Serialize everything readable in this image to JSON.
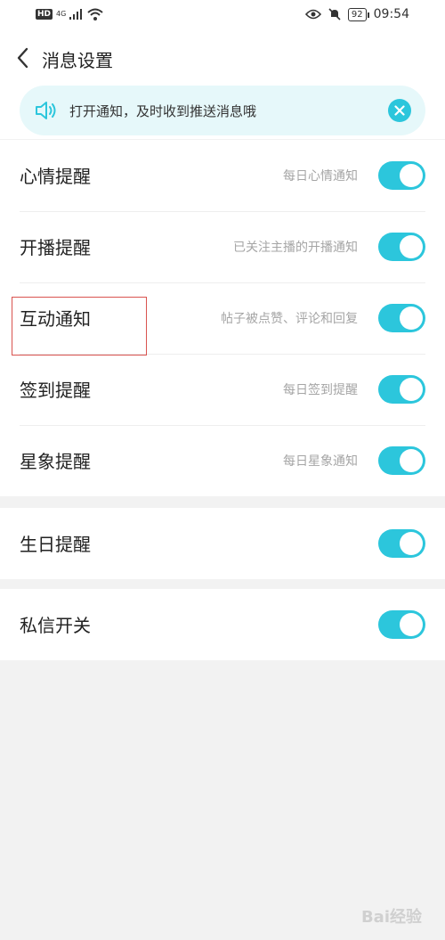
{
  "status_bar": {
    "hd": "HD",
    "network": "4G",
    "battery": "92",
    "time": "09:54"
  },
  "header": {
    "title": "消息设置"
  },
  "banner": {
    "text": "打开通知，及时收到推送消息哦"
  },
  "group1": [
    {
      "title": "心情提醒",
      "subtitle": "每日心情通知",
      "enabled": true
    },
    {
      "title": "开播提醒",
      "subtitle": "已关注主播的开播通知",
      "enabled": true
    },
    {
      "title": "互动通知",
      "subtitle": "帖子被点赞、评论和回复",
      "enabled": true
    },
    {
      "title": "签到提醒",
      "subtitle": "每日签到提醒",
      "enabled": true
    },
    {
      "title": "星象提醒",
      "subtitle": "每日星象通知",
      "enabled": true
    }
  ],
  "group2": [
    {
      "title": "生日提醒",
      "enabled": true
    }
  ],
  "group3": [
    {
      "title": "私信开关",
      "enabled": true
    }
  ],
  "colors": {
    "accent": "#2cc6dc",
    "banner_bg": "#e6f8fa",
    "highlight": "#d9534f"
  },
  "watermark": "Bai经验"
}
